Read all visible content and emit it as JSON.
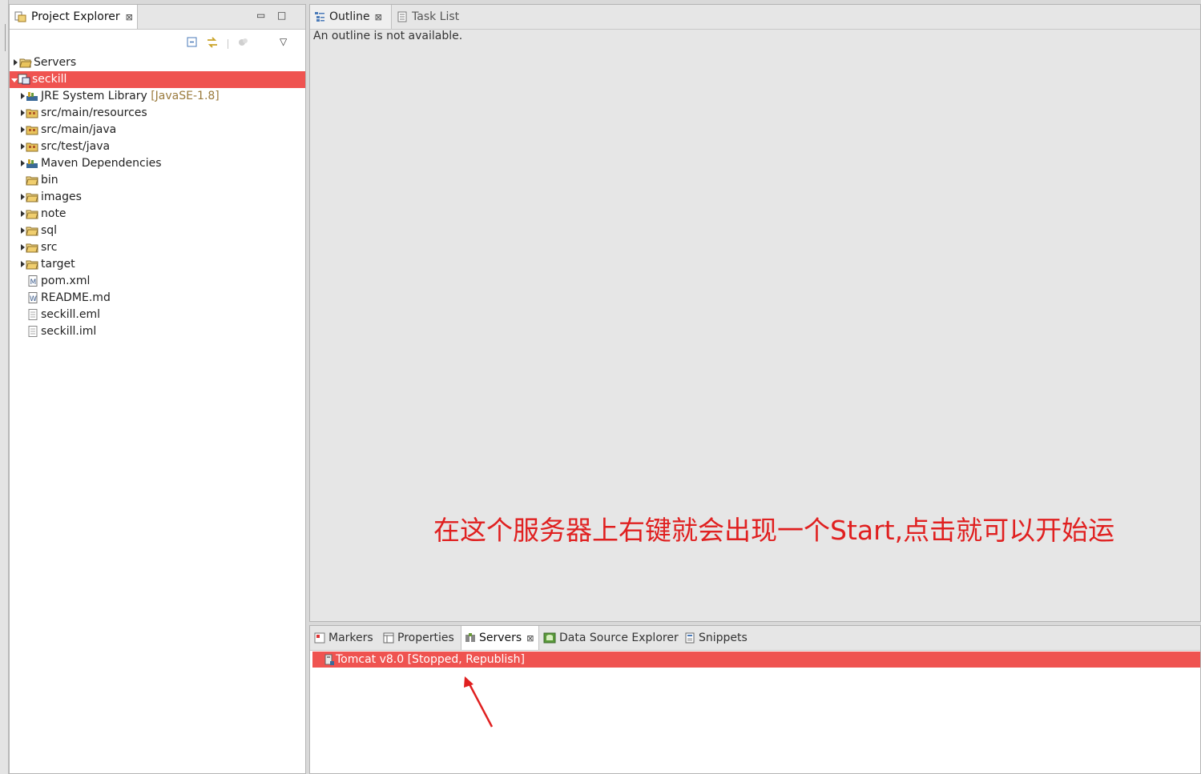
{
  "project_explorer": {
    "tab_label": "Project Explorer",
    "close_glyph": "⊠",
    "minimize_glyph": "▭",
    "maximize_glyph": "□",
    "view_menu_glyph": "▽",
    "tree": {
      "servers": "Servers",
      "seckill": "seckill",
      "jre": "JRE System Library",
      "jre_decoration": "[JavaSE-1.8]",
      "src_main_resources": "src/main/resources",
      "src_main_java": "src/main/java",
      "src_test_java": "src/test/java",
      "maven_deps": "Maven Dependencies",
      "bin": "bin",
      "images": "images",
      "note": "note",
      "sql": "sql",
      "src": "src",
      "target": "target",
      "pom": "pom.xml",
      "readme": "README.md",
      "seckill_eml": "seckill.eml",
      "seckill_iml": "seckill.iml"
    }
  },
  "outline": {
    "tab_outline": "Outline",
    "tab_task_list": "Task List",
    "close_glyph": "⊠",
    "message": "An outline is not available.",
    "annotation": "在这个服务器上右键就会出现一个Start,点击就可以开始运"
  },
  "servers_panel": {
    "tabs": {
      "markers": "Markers",
      "properties": "Properties",
      "servers": "Servers",
      "data_source_explorer": "Data Source Explorer",
      "snippets": "Snippets"
    },
    "close_glyph": "⊠",
    "server_row": "Tomcat v8.0   [Stopped, Republish]"
  },
  "colors": {
    "selection": "#ef5350",
    "annotation": "#e02020"
  }
}
